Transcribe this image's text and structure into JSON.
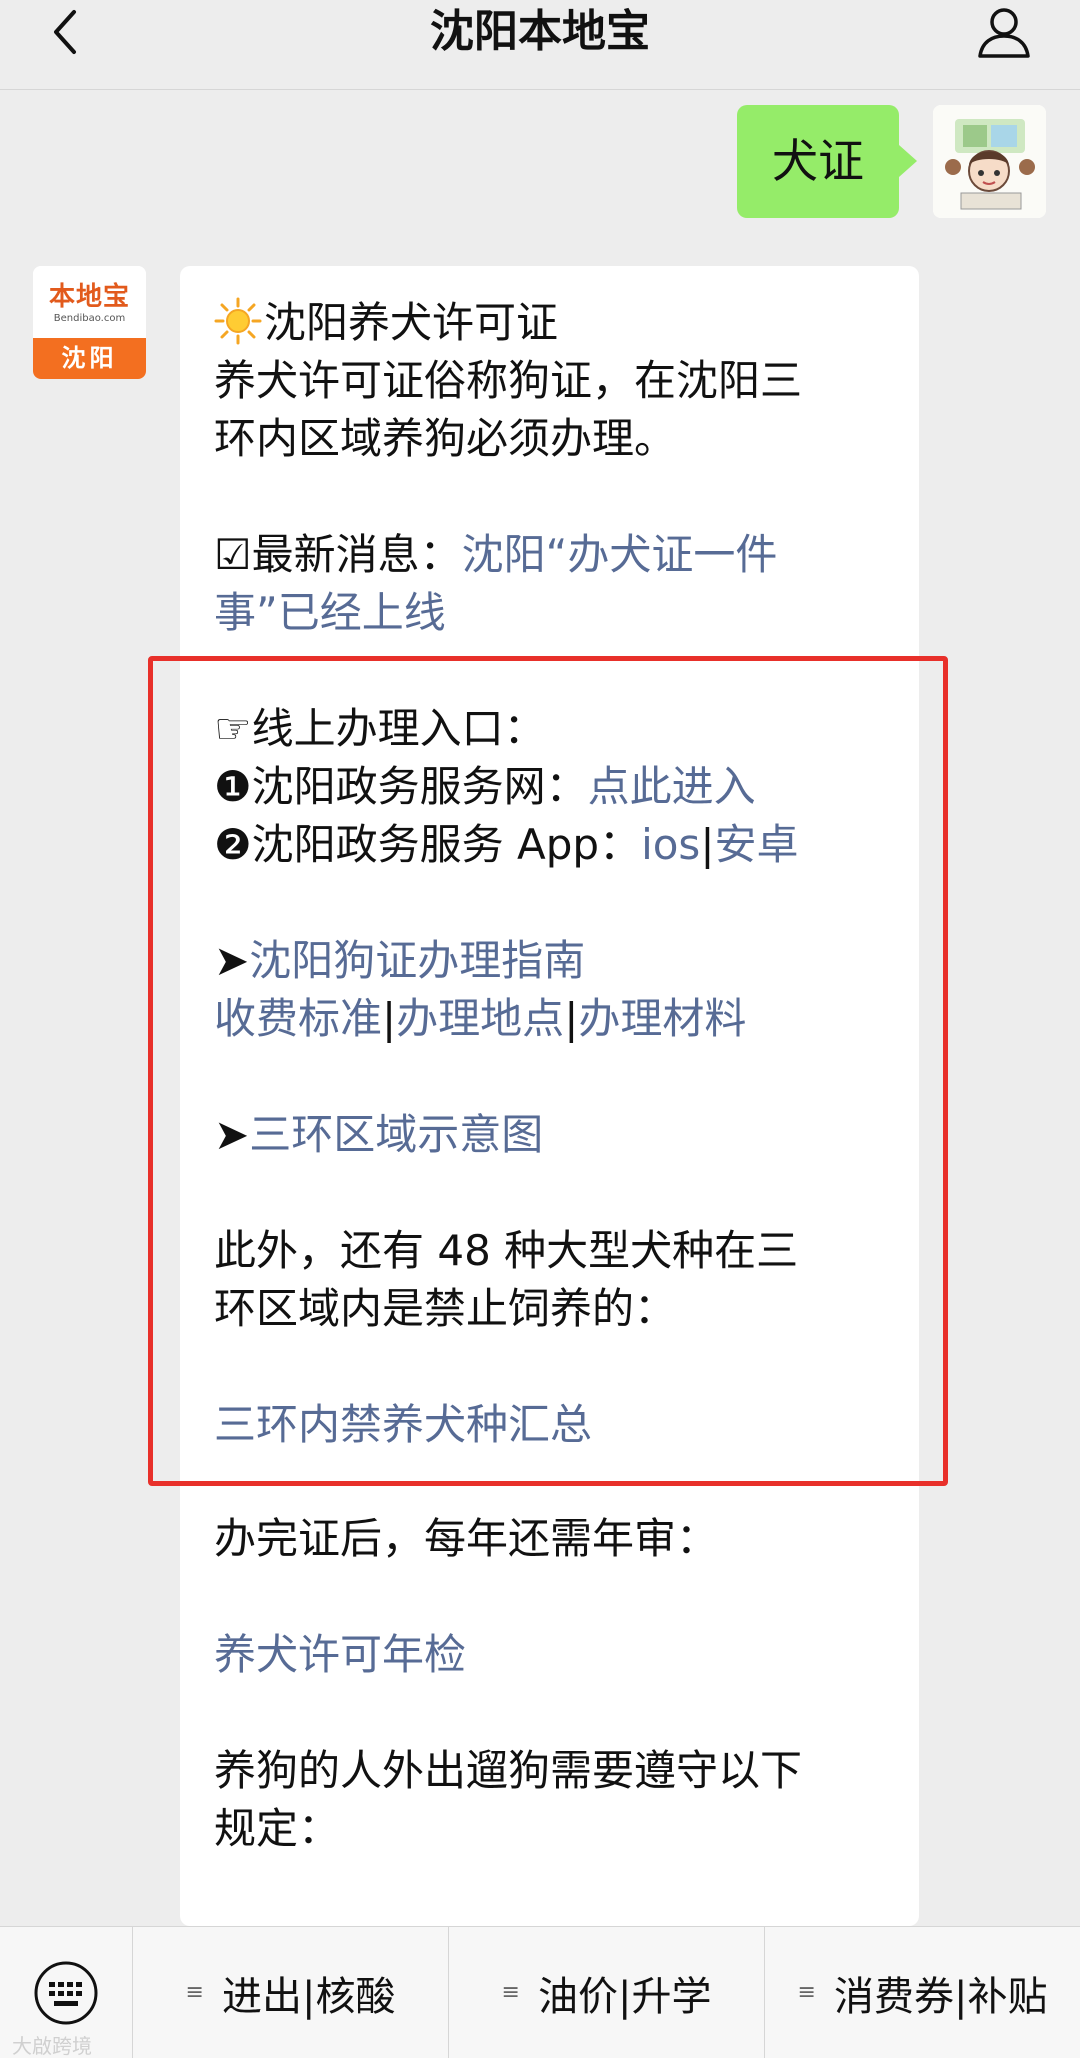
{
  "header": {
    "title": "沈阳本地宝"
  },
  "outgoing": {
    "text": "犬证"
  },
  "bot_avatar": {
    "brand": "本地宝",
    "domain": "Bendibao.com",
    "city": "沈阳"
  },
  "message": {
    "title": "沈阳养犬许可证",
    "intro_1": "养犬许可证俗称狗证，在沈阳三",
    "intro_2": "环内区域养狗必须办理。",
    "news_prefix": "☑最新消息：",
    "news_link_1": "沈阳“办犬证一件",
    "news_link_2": "事”已经上线",
    "online_heading": "☞线上办理入口：",
    "item1_prefix": "❶沈阳政务服务网：",
    "item1_link": "点此进入",
    "item2_prefix": "❷沈阳政务服务 App：",
    "item2_link_ios": "ios",
    "item2_sep": "|",
    "item2_link_android": "安卓",
    "guide_arrow": "➤",
    "guide_link": "沈阳狗证办理指南",
    "fee_link": "收费标准",
    "place_link": "办理地点",
    "material_link": "办理材料",
    "sep": "|",
    "map_arrow": "➤",
    "map_link": "三环区域示意图",
    "ban_1": "此外，还有 48 种大型犬种在三",
    "ban_2": "环区域内是禁止饲养的：",
    "ban_link": "三环内禁养犬种汇总",
    "annual_text": "办完证后，每年还需年审：",
    "annual_link": "养犬许可年检",
    "walk_1": "养狗的人外出遛狗需要遵守以下",
    "walk_2": "规定："
  },
  "bottom_menu": {
    "items": [
      {
        "label": "进出|核酸"
      },
      {
        "label": "油价|升学"
      },
      {
        "label": "消费券|补贴"
      }
    ]
  },
  "watermark": "大啟跨境",
  "colors": {
    "link": "#576b95",
    "outgoing_bubble": "#95ec69",
    "highlight_box": "#e8302a",
    "brand_orange": "#f36f20"
  }
}
